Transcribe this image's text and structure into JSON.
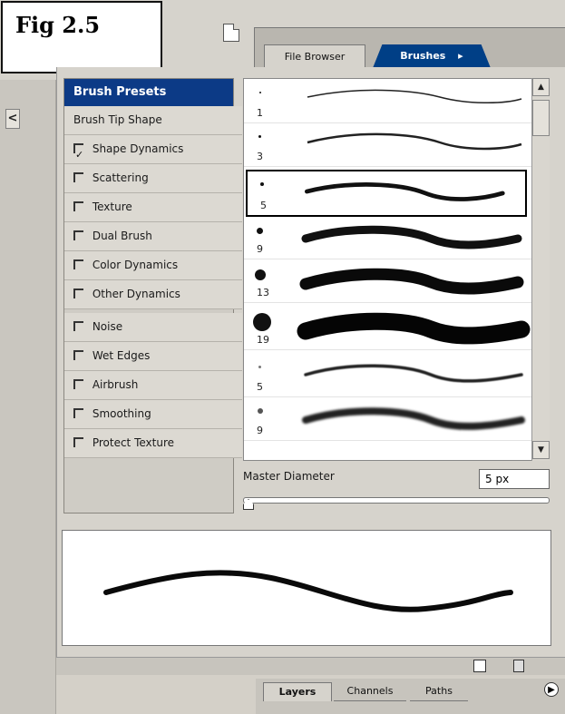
{
  "figure": {
    "label": "Fig 2.5"
  },
  "tabs": {
    "file_browser": "File Browser",
    "brushes": "Brushes",
    "brushes_arrow": "▸"
  },
  "options_panel": {
    "header": "Brush Presets",
    "items": [
      {
        "label": "Brush Tip Shape",
        "has_checkbox": false,
        "checked": false
      },
      {
        "label": "Shape Dynamics",
        "has_checkbox": true,
        "checked": true
      },
      {
        "label": "Scattering",
        "has_checkbox": true,
        "checked": false
      },
      {
        "label": "Texture",
        "has_checkbox": true,
        "checked": false
      },
      {
        "label": "Dual Brush",
        "has_checkbox": true,
        "checked": false
      },
      {
        "label": "Color Dynamics",
        "has_checkbox": true,
        "checked": false
      },
      {
        "label": "Other Dynamics",
        "has_checkbox": true,
        "checked": false
      },
      {
        "label": "Noise",
        "has_checkbox": true,
        "checked": false
      },
      {
        "label": "Wet Edges",
        "has_checkbox": true,
        "checked": false
      },
      {
        "label": "Airbrush",
        "has_checkbox": true,
        "checked": false
      },
      {
        "label": "Smoothing",
        "has_checkbox": true,
        "checked": false
      },
      {
        "label": "Protect Texture",
        "has_checkbox": true,
        "checked": false
      }
    ]
  },
  "brushes": [
    {
      "size": "1"
    },
    {
      "size": "3"
    },
    {
      "size": "5",
      "selected": true
    },
    {
      "size": "9"
    },
    {
      "size": "13"
    },
    {
      "size": "19"
    },
    {
      "size": "5"
    },
    {
      "size": "9"
    }
  ],
  "master_diameter": {
    "label": "Master Diameter",
    "value": "5 px"
  },
  "layers_tabs": {
    "layers": "Layers",
    "channels": "Channels",
    "paths": "Paths"
  },
  "icons": {
    "left_arrow": "<",
    "scroll_up": "▲",
    "scroll_down": "▼",
    "palette_menu": "▶"
  }
}
